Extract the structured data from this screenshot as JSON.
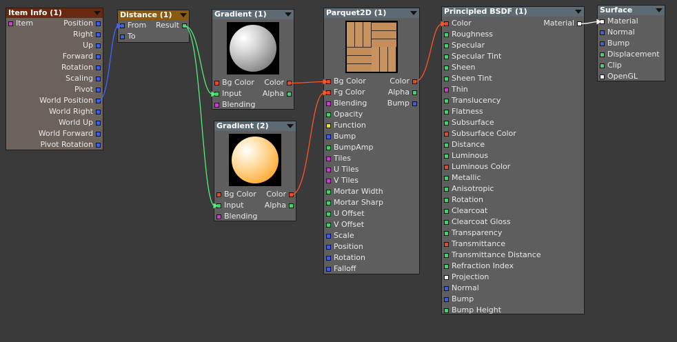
{
  "colors": {
    "color": "#e24a2a",
    "scalar": "#3ed66a",
    "vector": "#3a5ee8",
    "integer": "#cc3fcc",
    "function": "#e8e03a",
    "material": "#f2f2f2",
    "wire_green": "#52f078",
    "wire_blue": "#4466ff",
    "wire_orange": "#ff5522",
    "wire_white": "#ffffff"
  },
  "nodes": {
    "item_info": {
      "title": "Item Info (1)",
      "header_color": "#6a2810",
      "in_ports": [
        {
          "label": "Item",
          "type": "integer"
        }
      ],
      "out_ports": [
        {
          "label": "Position",
          "type": "vector"
        },
        {
          "label": "Right",
          "type": "vector"
        },
        {
          "label": "Up",
          "type": "vector"
        },
        {
          "label": "Forward",
          "type": "vector"
        },
        {
          "label": "Rotation",
          "type": "vector"
        },
        {
          "label": "Scaling",
          "type": "vector"
        },
        {
          "label": "Pivot",
          "type": "vector"
        },
        {
          "label": "World Position",
          "type": "vector"
        },
        {
          "label": "World Right",
          "type": "vector"
        },
        {
          "label": "World Up",
          "type": "vector"
        },
        {
          "label": "World Forward",
          "type": "vector"
        },
        {
          "label": "Pivot Rotation",
          "type": "vector"
        }
      ]
    },
    "distance": {
      "title": "Distance (1)",
      "header_color": "#8a5a10",
      "ports": [
        {
          "left": "From",
          "left_type": "vector",
          "right": "Result",
          "right_type": "scalar"
        },
        {
          "left": "To",
          "left_type": "vector"
        }
      ]
    },
    "gradient1": {
      "title": "Gradient (1)",
      "header_color": "#5b6a73",
      "preview": "gray",
      "ports": [
        {
          "left": "Bg Color",
          "left_type": "color",
          "right": "Color",
          "right_type": "color"
        },
        {
          "left": "Input",
          "left_type": "scalar",
          "right": "Alpha",
          "right_type": "scalar"
        },
        {
          "left": "Blending",
          "left_type": "integer"
        }
      ]
    },
    "gradient2": {
      "title": "Gradient (2)",
      "header_color": "#5b6a73",
      "preview": "orange",
      "ports": [
        {
          "left": "Bg Color",
          "left_type": "color",
          "right": "Color",
          "right_type": "color"
        },
        {
          "left": "Input",
          "left_type": "scalar",
          "right": "Alpha",
          "right_type": "scalar"
        },
        {
          "left": "Blending",
          "left_type": "integer"
        }
      ]
    },
    "parquet": {
      "title": "Parquet2D (1)",
      "header_color": "#5b6a73",
      "preview": "parquet",
      "ports": [
        {
          "left": "Bg Color",
          "left_type": "color",
          "right": "Color",
          "right_type": "color"
        },
        {
          "left": "Fg Color",
          "left_type": "color",
          "right": "Alpha",
          "right_type": "scalar"
        },
        {
          "left": "Blending",
          "left_type": "integer",
          "right": "Bump",
          "right_type": "vector"
        },
        {
          "left": "Opacity",
          "left_type": "scalar"
        },
        {
          "left": "Function",
          "left_type": "function"
        },
        {
          "left": "Bump",
          "left_type": "vector"
        },
        {
          "left": "BumpAmp",
          "left_type": "scalar"
        },
        {
          "left": "Tiles",
          "left_type": "integer"
        },
        {
          "left": "U Tiles",
          "left_type": "integer"
        },
        {
          "left": "V Tiles",
          "left_type": "integer"
        },
        {
          "left": "Mortar Width",
          "left_type": "scalar"
        },
        {
          "left": "Mortar Sharp",
          "left_type": "scalar"
        },
        {
          "left": "U Offset",
          "left_type": "scalar"
        },
        {
          "left": "V Offset",
          "left_type": "scalar"
        },
        {
          "left": "Scale",
          "left_type": "vector"
        },
        {
          "left": "Position",
          "left_type": "vector"
        },
        {
          "left": "Rotation",
          "left_type": "vector"
        },
        {
          "left": "Falloff",
          "left_type": "vector"
        }
      ]
    },
    "principled": {
      "title": "Principled BSDF (1)",
      "header_color": "#5b6a73",
      "ports": [
        {
          "left": "Color",
          "left_type": "color",
          "right": "Material",
          "right_type": "material"
        },
        {
          "left": "Roughness",
          "left_type": "scalar"
        },
        {
          "left": "Specular",
          "left_type": "scalar"
        },
        {
          "left": "Specular Tint",
          "left_type": "scalar"
        },
        {
          "left": "Sheen",
          "left_type": "scalar"
        },
        {
          "left": "Sheen Tint",
          "left_type": "scalar"
        },
        {
          "left": "Thin",
          "left_type": "integer"
        },
        {
          "left": "Translucency",
          "left_type": "scalar"
        },
        {
          "left": "Flatness",
          "left_type": "scalar"
        },
        {
          "left": "Subsurface",
          "left_type": "scalar"
        },
        {
          "left": "Subsurface Color",
          "left_type": "color"
        },
        {
          "left": "Distance",
          "left_type": "scalar"
        },
        {
          "left": "Luminous",
          "left_type": "scalar"
        },
        {
          "left": "Luminous Color",
          "left_type": "color"
        },
        {
          "left": "Metallic",
          "left_type": "scalar"
        },
        {
          "left": "Anisotropic",
          "left_type": "scalar"
        },
        {
          "left": "Rotation",
          "left_type": "scalar"
        },
        {
          "left": "Clearcoat",
          "left_type": "scalar"
        },
        {
          "left": "Clearcoat Gloss",
          "left_type": "scalar"
        },
        {
          "left": "Transparency",
          "left_type": "scalar"
        },
        {
          "left": "Transmittance",
          "left_type": "color"
        },
        {
          "left": "Transmittance Distance",
          "left_type": "scalar"
        },
        {
          "left": "Refraction Index",
          "left_type": "scalar"
        },
        {
          "left": "Projection",
          "left_type": "material"
        },
        {
          "left": "Normal",
          "left_type": "vector"
        },
        {
          "left": "Bump",
          "left_type": "vector"
        },
        {
          "left": "Bump Height",
          "left_type": "scalar"
        }
      ]
    },
    "surface": {
      "title": "Surface",
      "header_color": "#5b6a73",
      "ports": [
        {
          "left": "Material",
          "left_type": "material"
        },
        {
          "left": "Normal",
          "left_type": "vector"
        },
        {
          "left": "Bump",
          "left_type": "vector"
        },
        {
          "left": "Displacement",
          "left_type": "scalar"
        },
        {
          "left": "Clip",
          "left_type": "scalar"
        },
        {
          "left": "OpenGL",
          "left_type": "material"
        }
      ]
    }
  }
}
